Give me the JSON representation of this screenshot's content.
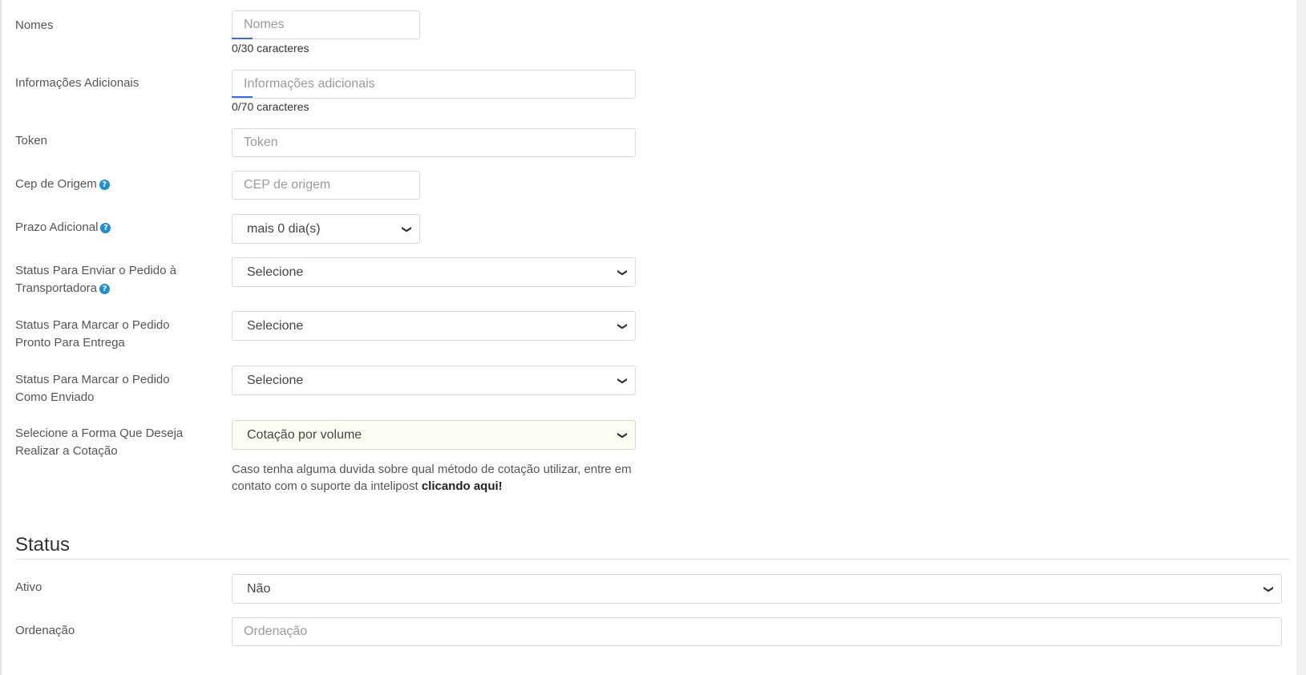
{
  "fields": {
    "nomes": {
      "label": "Nomes",
      "placeholder": "Nomes",
      "counter": "0/30 caracteres"
    },
    "info": {
      "label": "Informações Adicionais",
      "placeholder": "Informações adicionais",
      "counter": "0/70 caracteres"
    },
    "token": {
      "label": "Token",
      "placeholder": "Token"
    },
    "cep": {
      "label": "Cep de Origem",
      "placeholder": "CEP de origem"
    },
    "prazo": {
      "label": "Prazo Adicional",
      "value": "mais 0 dia(s)"
    },
    "status_enviar": {
      "label_line1": "Status Para Enviar o Pedido à",
      "label_line2": "Transportadora",
      "value": "Selecione"
    },
    "status_pronto": {
      "label_line1": "Status Para Marcar o Pedido",
      "label_line2": "Pronto Para Entrega",
      "value": "Selecione"
    },
    "status_enviado": {
      "label_line1": "Status Para Marcar o Pedido",
      "label_line2": "Como Enviado",
      "value": "Selecione"
    },
    "cotacao": {
      "label_line1": "Selecione a Forma Que Deseja",
      "label_line2": "Realizar a Cotação",
      "value": "Cotação por volume",
      "help_text": "Caso tenha alguma duvida sobre qual método de cotação utilizar, entre em contato com o suporte da intelipost ",
      "help_link": "clicando aqui!"
    }
  },
  "status_section": {
    "title": "Status",
    "ativo": {
      "label": "Ativo",
      "value": "Não"
    },
    "ordenacao": {
      "label": "Ordenação",
      "placeholder": "Ordenação"
    }
  },
  "icons": {
    "help": "question-circle-icon",
    "chevron": "chevron-down-icon"
  },
  "colors": {
    "help_icon": "#1e8fd1",
    "accent_underline": "#2f6fd6",
    "cotacao_bg": "#fdfdf5"
  }
}
